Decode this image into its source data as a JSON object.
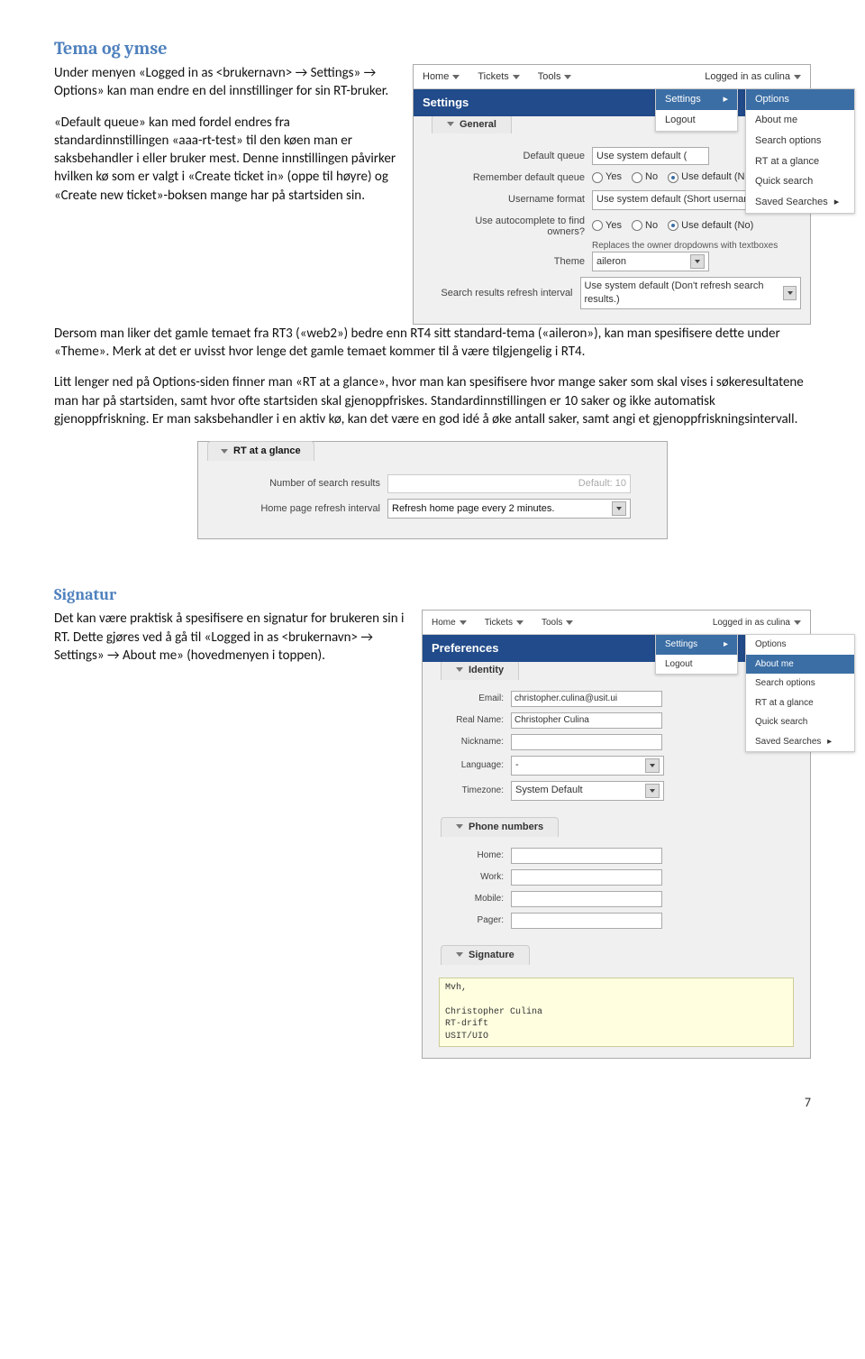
{
  "doc": {
    "section1_title": "Tema og ymse",
    "para1": "Under menyen «Logged in as <brukernavn> → Settings» → Options» kan man endre en del innstillinger for sin RT-bruker.",
    "para2": "«Default queue» kan med fordel endres fra standardinnstillingen «aaa-rt-test» til den køen man er saksbehandler i eller bruker mest. Denne innstillingen påvirker hvilken kø som er valgt i «Create ticket in» (oppe til høyre) og «Create new ticket»-boksen mange har på startsiden sin.",
    "para3": "Dersom man liker det gamle temaet fra RT3 («web2») bedre enn RT4 sitt standard-tema («aileron»), kan man spesifisere dette under «Theme». Merk at det er uvisst hvor lenge det gamle temaet kommer til å være tilgjengelig i RT4.",
    "para4": "Litt lenger ned på Options-siden finner man «RT at a glance», hvor man kan spesifisere hvor mange saker som skal vises i søkeresultatene man har på startsiden, samt hvor ofte startsiden skal gjenoppfriskes. Standardinnstillingen er 10 saker og ikke automatisk gjenoppfriskning. Er man saksbehandler i en aktiv kø, kan det være en god idé å øke antall saker, samt angi et gjenoppfriskningsintervall.",
    "section2_title": "Signatur",
    "para5": "Det kan være praktisk å spesifisere en signatur for brukeren sin i RT. Dette gjøres ved å gå til «Logged in as <brukernavn> → Settings» → About me» (hovedmenyen i toppen).",
    "page_number": "7"
  },
  "shot1": {
    "nav": {
      "home": "Home",
      "tickets": "Tickets",
      "tools": "Tools",
      "logged": "Logged in as culina"
    },
    "submenu": {
      "settings": "Settings",
      "logout": "Logout"
    },
    "submenu2": [
      "Options",
      "About me",
      "Search options",
      "RT at a glance",
      "Quick search",
      "Saved Searches"
    ],
    "title": "Settings",
    "tab": "General",
    "rows": {
      "default_queue": {
        "label": "Default queue",
        "value": "Use system default ("
      },
      "remember": {
        "label": "Remember default queue",
        "yes": "Yes",
        "no": "No",
        "def": "Use default (No)"
      },
      "username_format": {
        "label": "Username format",
        "value": "Use system default (Short usernames)"
      },
      "autocomplete": {
        "label": "Use autocomplete to find owners?",
        "yes": "Yes",
        "no": "No",
        "def": "Use default (No)",
        "note": "Replaces the owner dropdowns with textboxes"
      },
      "theme": {
        "label": "Theme",
        "value": "aileron"
      },
      "refresh": {
        "label": "Search results refresh interval",
        "value": "Use system default (Don't refresh search results.)"
      }
    }
  },
  "shot2": {
    "tab": "RT at a glance",
    "row1_label": "Number of search results",
    "row1_ph": "Default: 10",
    "row2_label": "Home page refresh interval",
    "row2_value": "Refresh home page every 2 minutes."
  },
  "shot3": {
    "nav": {
      "home": "Home",
      "tickets": "Tickets",
      "tools": "Tools",
      "logged": "Logged in as culina"
    },
    "submenu": {
      "settings": "Settings",
      "logout": "Logout"
    },
    "submenu2": [
      "Options",
      "About me",
      "Search options",
      "RT at a glance",
      "Quick search",
      "Saved Searches"
    ],
    "title": "Preferences",
    "tab_identity": "Identity",
    "identity": {
      "email_l": "Email:",
      "email_v": "christopher.culina@usit.ui",
      "real_l": "Real Name:",
      "real_v": "Christopher Culina",
      "nick_l": "Nickname:",
      "nick_v": "",
      "lang_l": "Language:",
      "lang_v": "-",
      "tz_l": "Timezone:",
      "tz_v": "System Default"
    },
    "tab_phone": "Phone numbers",
    "phones": {
      "home": "Home:",
      "work": "Work:",
      "mobile": "Mobile:",
      "pager": "Pager:"
    },
    "tab_sig": "Signature",
    "signature": "Mvh,\n\nChristopher Culina\nRT-drift\nUSIT/UIO"
  }
}
